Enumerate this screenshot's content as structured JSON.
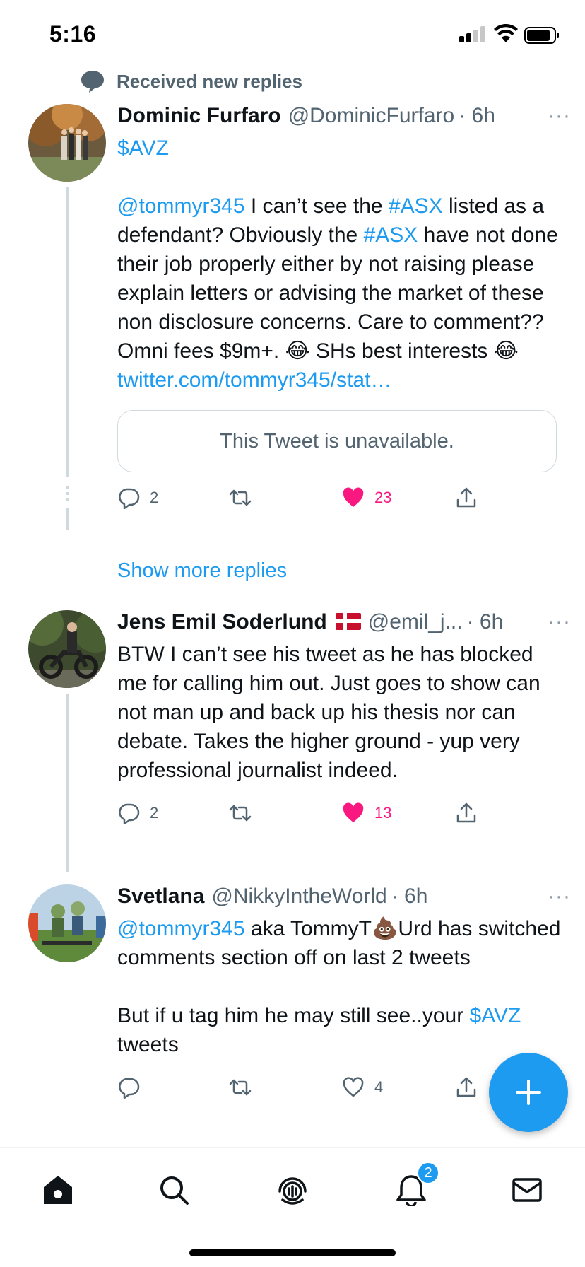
{
  "status_bar": {
    "time": "5:16"
  },
  "social_context": {
    "label": "Received new replies",
    "icon": "comment-bubble-icon"
  },
  "tweets": [
    {
      "name": "Dominic Furfaro",
      "handle": "@DominicFurfaro",
      "time": "· 6h",
      "more": "···",
      "text": {
        "t1": "$AVZ",
        "t2": "@tommyr345",
        "t3": " I can’t see the ",
        "t4": "#ASX",
        "t5": " listed as a defendant? Obviously the ",
        "t6": "#ASX",
        "t7": " have not done their job properly either by not raising please explain letters or advising the market of these non disclosure concerns. Care to comment?? Omni fees $9m+. ",
        "t8": "😂",
        "t9": " SHs best interests ",
        "t10": "😂",
        "t11": " twitter.com/tommyr345/stat…"
      },
      "quote": "This Tweet is unavailable.",
      "replies": "2",
      "retweets": "",
      "likes": "23",
      "liked": true
    },
    {
      "name": "Jens Emil Soderlund",
      "flag": "denmark-flag",
      "handle": "@emil_j...",
      "time": "· 6h",
      "more": "···",
      "text": "BTW I can’t see his tweet as he has blocked me for calling him out. Just goes to show can not man up and back up his thesis nor can debate. Takes the higher ground - yup very professional journalist indeed.",
      "replies": "2",
      "retweets": "",
      "likes": "13",
      "liked": true
    },
    {
      "name": "Svetlana",
      "handle": "@NikkyIntheWorld",
      "time": "· 6h",
      "more": "···",
      "text": {
        "t1": "@tommyr345",
        "t2": " aka TommyT",
        "t3": "💩",
        "t4": "Urd has switched comments section off on last 2 tweets",
        "t5": "But if u tag him he may still see..your ",
        "t6": "$AVZ",
        "t7": " tweets"
      },
      "replies": "",
      "retweets": "",
      "likes": "4",
      "liked": false
    }
  ],
  "show_more_replies": "Show more replies",
  "nav": {
    "items": [
      "home-icon",
      "search-icon",
      "spaces-icon",
      "notifications-icon",
      "messages-icon"
    ],
    "notifications_badge": "2"
  },
  "colors": {
    "accent": "#1d9bf0",
    "like": "#f91880",
    "secondary_text": "#536471",
    "thread_line": "#cfd9de"
  }
}
